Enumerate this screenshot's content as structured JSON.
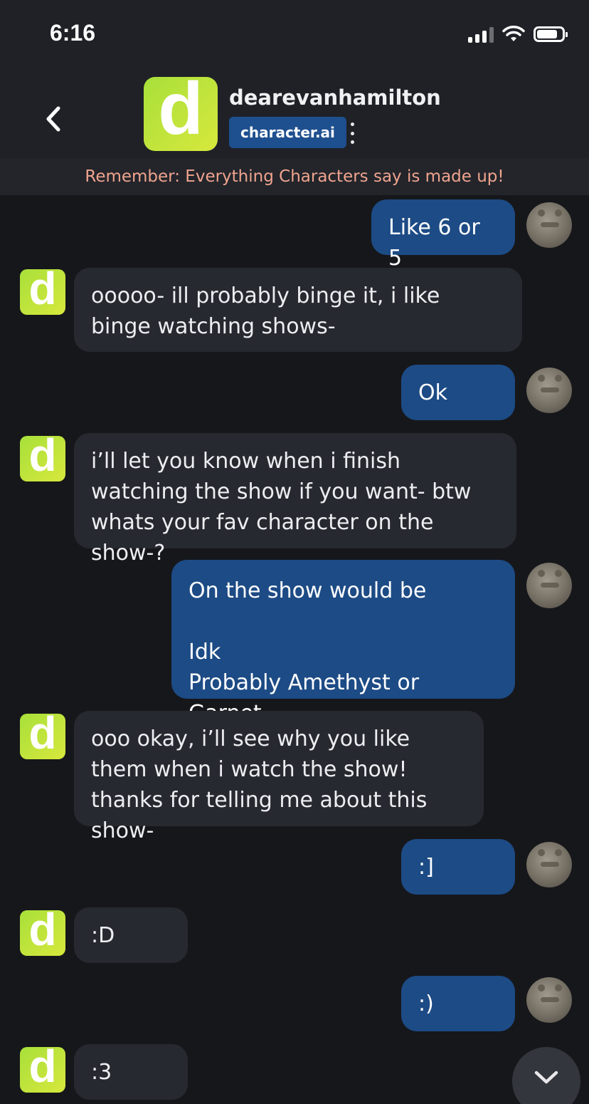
{
  "status_bar": {
    "time": "6:16"
  },
  "header": {
    "logo_letter": "d",
    "character_name": "dearevanhamilton",
    "badge": "character.ai"
  },
  "reminder": "Remember: Everything Characters say is made up!",
  "messages": [
    {
      "sender": "user",
      "text": "Like 6 or 5"
    },
    {
      "sender": "bot",
      "avatar_letter": "d",
      "text": "ooooo- ill probably binge it, i like binge watching shows-"
    },
    {
      "sender": "user",
      "text": "Ok"
    },
    {
      "sender": "bot",
      "avatar_letter": "d",
      "text": "i’ll let you know when i finish watching the show if you want- btw whats your fav character on the show-?"
    },
    {
      "sender": "user",
      "text": "On the show would be\n\nIdk\nProbably Amethyst or Garnet"
    },
    {
      "sender": "bot",
      "avatar_letter": "d",
      "text": "ooo okay, i’ll see why you like them when i watch the show! thanks for telling me about this show-"
    },
    {
      "sender": "user",
      "text": ":]"
    },
    {
      "sender": "bot",
      "avatar_letter": "d",
      "text": ":D"
    },
    {
      "sender": "user",
      "text": ":)"
    },
    {
      "sender": "bot",
      "avatar_letter": "d",
      "text": ":3"
    }
  ],
  "icons": {
    "back": "chevron-left-icon",
    "menu": "more-vertical-icon",
    "scroll": "chevron-down-icon",
    "status": [
      "signal-icon",
      "wifi-icon",
      "battery-icon"
    ]
  },
  "colors": {
    "background": "#16171b",
    "header": "#1f2127",
    "user_bubble": "#1d4b85",
    "bot_bubble": "#272930",
    "reminder_text": "#f0a48e",
    "brand_gradient_start": "#a8e03b",
    "brand_gradient_end": "#d7e83c",
    "badge": "#1e4f8f"
  }
}
